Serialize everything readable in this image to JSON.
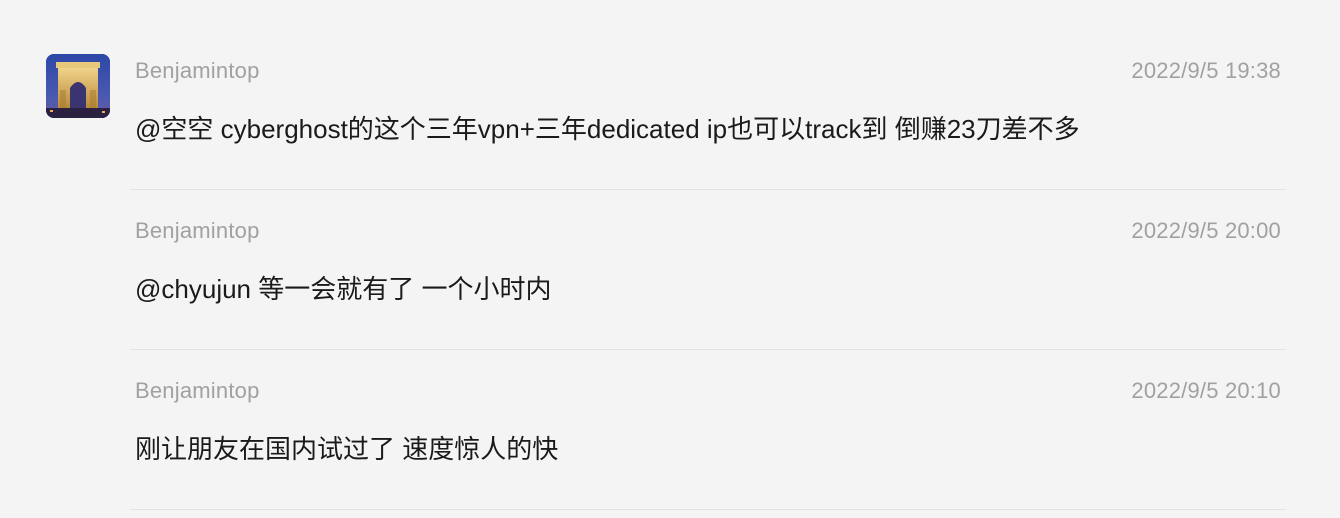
{
  "comments": [
    {
      "author": "Benjamintop",
      "timestamp": "2022/9/5 19:38",
      "text": "@空空 cyberghost的这个三年vpn+三年dedicated ip也可以track到 倒赚23刀差不多"
    },
    {
      "author": "Benjamintop",
      "timestamp": "2022/9/5 20:00",
      "text": "@chyujun 等一会就有了 一个小时内"
    },
    {
      "author": "Benjamintop",
      "timestamp": "2022/9/5 20:10",
      "text": "刚让朋友在国内试过了 速度惊人的快"
    }
  ],
  "avatar": {
    "icon": "arc-de-triomphe-photo-icon",
    "colors": {
      "sky": "#2d47a8",
      "sky_low": "#6a5aa0",
      "stone": "#d9b25a",
      "ground": "#2a2040"
    }
  }
}
